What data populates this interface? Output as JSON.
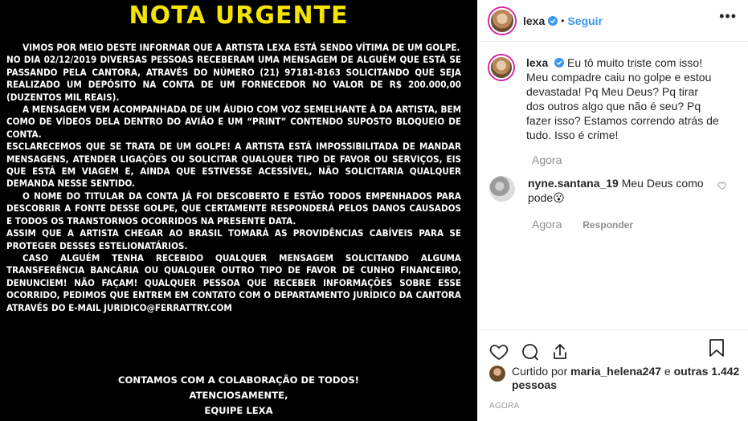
{
  "post_image": {
    "title": "NOTA URGENTE",
    "paragraphs": [
      {
        "indent": true,
        "text": "Vimos por meio deste informar que a artista Lexa está sendo vítima de um golpe."
      },
      {
        "indent": false,
        "text": "No dia  02/12/2019 diversas pessoas receberam uma mensagem de alguém que está se passando pela cantora, através do número (21) 97181-8163 solicitando que seja realizado um depósito na conta de um fornecedor no valor de R$ 200.000,00 (duzentos mil reais)."
      },
      {
        "indent": true,
        "text": "A mensagem vem acompanhada de um áudio com voz semelhante à da artista, bem como de vídeos dela dentro do avião e um “print” contendo suposto bloqueio de conta."
      },
      {
        "indent": false,
        "text": "Esclarecemos que se trata de um golpe! A artista está impossibilitada de mandar mensagens, atender ligações ou solicitar qualquer tipo de favor ou serviços, eis que está em viagem e, ainda que estivesse acessível, não solicitaria qualquer demanda nesse sentido."
      },
      {
        "indent": true,
        "text": "O nome do titular da conta já foi descoberto e estão todos empenhados para descobrir a fonte desse golpe, que certamente responderá pelos danos causados e todos os transtornos ocorridos na presente data."
      },
      {
        "indent": false,
        "text": "Assim que a artista chegar ao Brasil tomará as providências cabíveis para se proteger desses estelionatários."
      },
      {
        "indent": true,
        "text": "Caso alguém tenha recebido qualquer mensagem solicitando alguma transferência bancária ou qualquer outro tipo de favor de cunho financeiro, denunciem! Não façam! Qualquer pessoa que receber informações sobre esse ocorrido, pedimos que entrem em contato com o departamento jurídico da cantora através do e-mail juridico@ferrattry.com"
      }
    ],
    "footer": [
      "Contamos com a colaboração de todos!",
      "Atenciosamente,",
      "Equipe Lexa"
    ]
  },
  "header": {
    "username": "lexa",
    "separator": "•",
    "follow_label": "Seguir",
    "more": "•••"
  },
  "caption": {
    "username": "lexa",
    "text": "Eu tô muito triste com isso! Meu compadre caiu no golpe e estou devastada! Pq Meu Deus? Pq tirar dos outros algo que não é seu? Pq fazer isso? Estamos correndo atrás de tudo. Isso é crime!",
    "time": "Agora"
  },
  "comment": {
    "username": "nyne.santana_19",
    "text": "Meu Deus como pode😮",
    "time": "Agora",
    "reply_label": "Responder"
  },
  "likes": {
    "prefix": "Curtido por",
    "user": "maria_helena247",
    "and": "e",
    "others": "outras 1.442 pessoas"
  },
  "timestamp": "Agora",
  "colors": {
    "title_yellow": "#f5e400",
    "follow_blue": "#3897f0",
    "verified_blue": "#3897f0"
  }
}
